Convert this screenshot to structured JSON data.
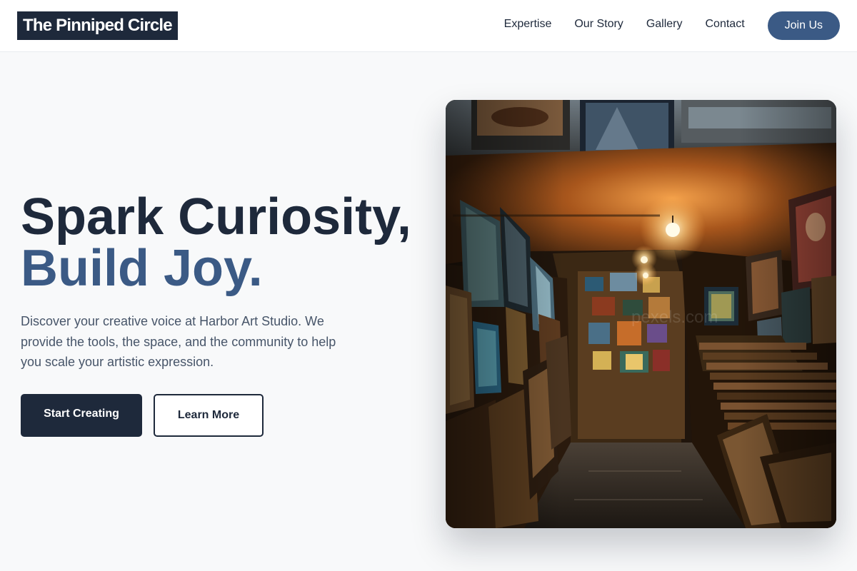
{
  "header": {
    "logo": "The Pinniped Circle",
    "nav": [
      {
        "label": "Expertise"
      },
      {
        "label": "Our Story"
      },
      {
        "label": "Gallery"
      },
      {
        "label": "Contact"
      }
    ],
    "join_label": "Join Us"
  },
  "hero": {
    "title_line1": "Spark Curiosity,",
    "title_line2": "Build Joy.",
    "description": "Discover your creative voice at Harbor Art Studio. We provide the tools, the space, and the community to help you scale your artistic expression.",
    "primary_cta": "Start Creating",
    "secondary_cta": "Learn More",
    "image": "art-gallery-corridor-photo"
  },
  "colors": {
    "navy": "#1e293b",
    "accent_blue": "#3b5a85",
    "body_text": "#475569",
    "background": "#f8f9fa"
  }
}
